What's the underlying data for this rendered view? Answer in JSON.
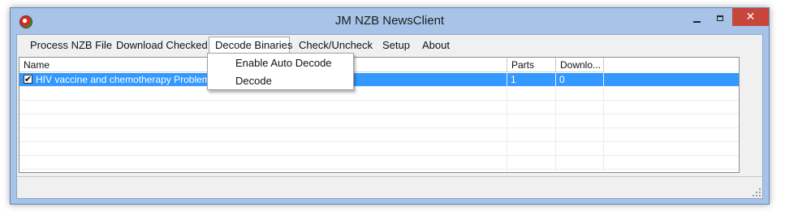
{
  "window": {
    "title": "JM NZB NewsClient",
    "controls": {
      "minimize": "minimize",
      "maximize": "maximize",
      "close": "✕"
    }
  },
  "menu": {
    "items": [
      "Process NZB File",
      "Download Checked",
      "Decode Binaries",
      "Check/Uncheck",
      "Setup",
      "About"
    ],
    "open_menu": "Decode Binaries"
  },
  "dropdown": {
    "items": [
      "Enable Auto Decode",
      "Decode"
    ]
  },
  "list": {
    "columns": [
      "Name",
      "Parts",
      "Downlo..."
    ],
    "rows": [
      {
        "checked": true,
        "check_glyph": "✔",
        "name": "HIV vaccine and chemotherapy  Problems ar",
        "parts": "1",
        "downloaded": "0",
        "selected": true
      }
    ]
  },
  "colors": {
    "selection": "#3399ff",
    "titlebar": "#a7c4e8",
    "close_button": "#c7463a"
  },
  "icons": [
    "app-logo-icon",
    "minimize-icon",
    "maximize-icon",
    "close-icon",
    "checkbox-checked-icon",
    "size-grip-icon"
  ]
}
